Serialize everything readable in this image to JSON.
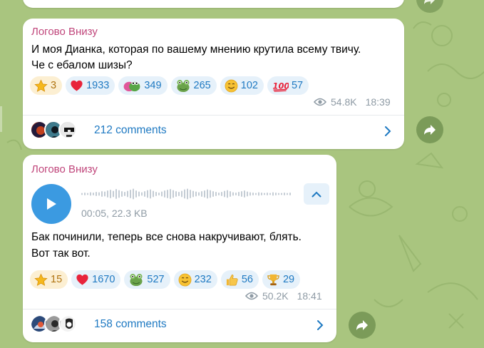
{
  "colors": {
    "background": "#a9c57f",
    "sender": "#c0467b",
    "accent": "#1e79c2",
    "paid_star": "#b07411"
  },
  "messages": [
    {
      "sender": "Логово Внизу",
      "text_lines": [
        "И моя Дианка, которая по вашему мнению крутила всему твичу.",
        "Че с ебалом шизы?"
      ],
      "reactions": [
        {
          "icon": "star-icon",
          "count": "3",
          "paid": true
        },
        {
          "icon": "heart-icon",
          "count": "1933"
        },
        {
          "icon": "frog-hug-icon",
          "count": "349"
        },
        {
          "icon": "frog-face-icon",
          "count": "265"
        },
        {
          "icon": "smile-icon",
          "count": "102"
        },
        {
          "icon": "hundred-icon",
          "count": "57"
        }
      ],
      "views": "54.8K",
      "time": "18:39",
      "comments": "212 comments"
    },
    {
      "sender": "Логово Внизу",
      "voice": {
        "duration": "00:05",
        "size": "22.3 KB",
        "meta": "00:05, 22.3 KB"
      },
      "text_lines": [
        "Бак починили, теперь все снова накручивают, блять.",
        "Вот так вот."
      ],
      "reactions": [
        {
          "icon": "star-icon",
          "count": "15",
          "paid": true
        },
        {
          "icon": "heart-icon",
          "count": "1670"
        },
        {
          "icon": "frog-face-icon",
          "count": "527"
        },
        {
          "icon": "smile-icon",
          "count": "232"
        },
        {
          "icon": "thumbs-up-icon",
          "count": "56"
        },
        {
          "icon": "trophy-icon",
          "count": "29"
        }
      ],
      "views": "50.2K",
      "time": "18:41",
      "comments": "158 comments"
    }
  ]
}
